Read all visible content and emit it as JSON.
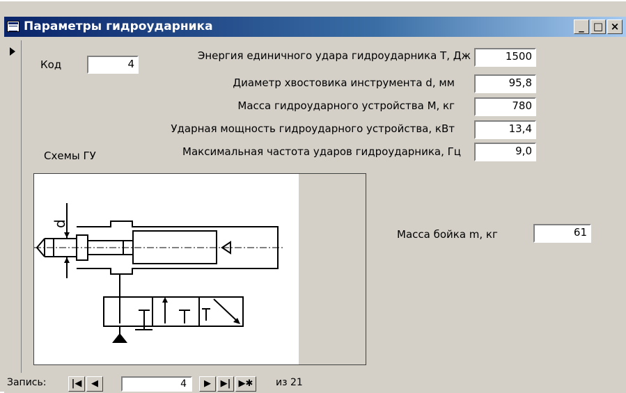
{
  "window": {
    "title": "Параметры гидроударника",
    "minimize_glyph": "_",
    "maximize_glyph": "□",
    "close_glyph": "×"
  },
  "form": {
    "kod_label": "Код",
    "kod_value": "4",
    "scheme_label": "Схемы ГУ",
    "fields": [
      {
        "label": "Энергия единичного удара гидроударника Т, Дж",
        "value": "1500"
      },
      {
        "label": "Диаметр хвостовика инструмента d, мм",
        "value": "95,8"
      },
      {
        "label": "Масса гидроударного устройства М, кг",
        "value": "780"
      },
      {
        "label": "Ударная мощность гидроударного устройства, кВт",
        "value": "13,4"
      },
      {
        "label": "Максимальная частота ударов гидроударника, Гц",
        "value": "9,0"
      }
    ],
    "striker_label": "Масса бойка m, кг",
    "striker_value": "61",
    "diagram_letter": "d"
  },
  "navigator": {
    "record_label": "Запись:",
    "current": "4",
    "of_text": "из 21",
    "first_icon": "first-record-icon",
    "prev_icon": "prev-record-icon",
    "next_icon": "next-record-icon",
    "last_icon": "last-record-icon",
    "new_icon": "new-record-icon"
  }
}
